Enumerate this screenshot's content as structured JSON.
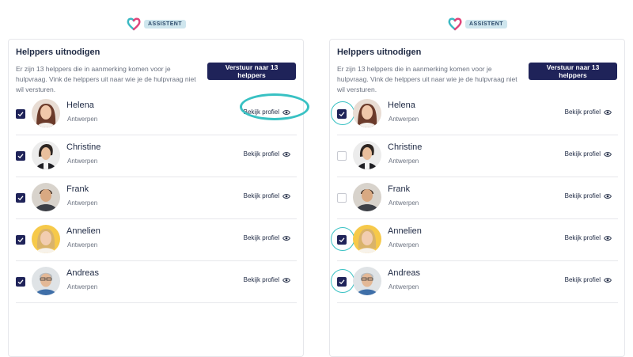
{
  "logo": {
    "badge": "ASSISTENT"
  },
  "panel": {
    "title": "Helppers uitnodigen",
    "description": "Er zijn 13 helppers die in aanmerking komen voor je hulpvraag. Vink de helppers uit naar wie je de hulpvraag niet wil versturen.",
    "send_button": "Verstuur naar 13 helppers",
    "profile_link": "Bekijk profiel",
    "icons": {
      "profile": "eye-icon",
      "checkbox": "check-icon",
      "logo": "heart-logo-icon"
    }
  },
  "helpers": [
    {
      "name": "Helena",
      "city": "Antwerpen"
    },
    {
      "name": "Christine",
      "city": "Antwerpen"
    },
    {
      "name": "Frank",
      "city": "Antwerpen"
    },
    {
      "name": "Annelien",
      "city": "Antwerpen"
    },
    {
      "name": "Andreas",
      "city": "Antwerpen"
    }
  ],
  "left_state": {
    "checked": [
      true,
      true,
      true,
      true,
      true
    ]
  },
  "right_state": {
    "checked": [
      true,
      false,
      false,
      true,
      true
    ]
  },
  "colors": {
    "primary": "#1f2359",
    "highlight": "#38c1c3",
    "logo_pink": "#e0457b",
    "logo_teal": "#3bb9c3"
  }
}
